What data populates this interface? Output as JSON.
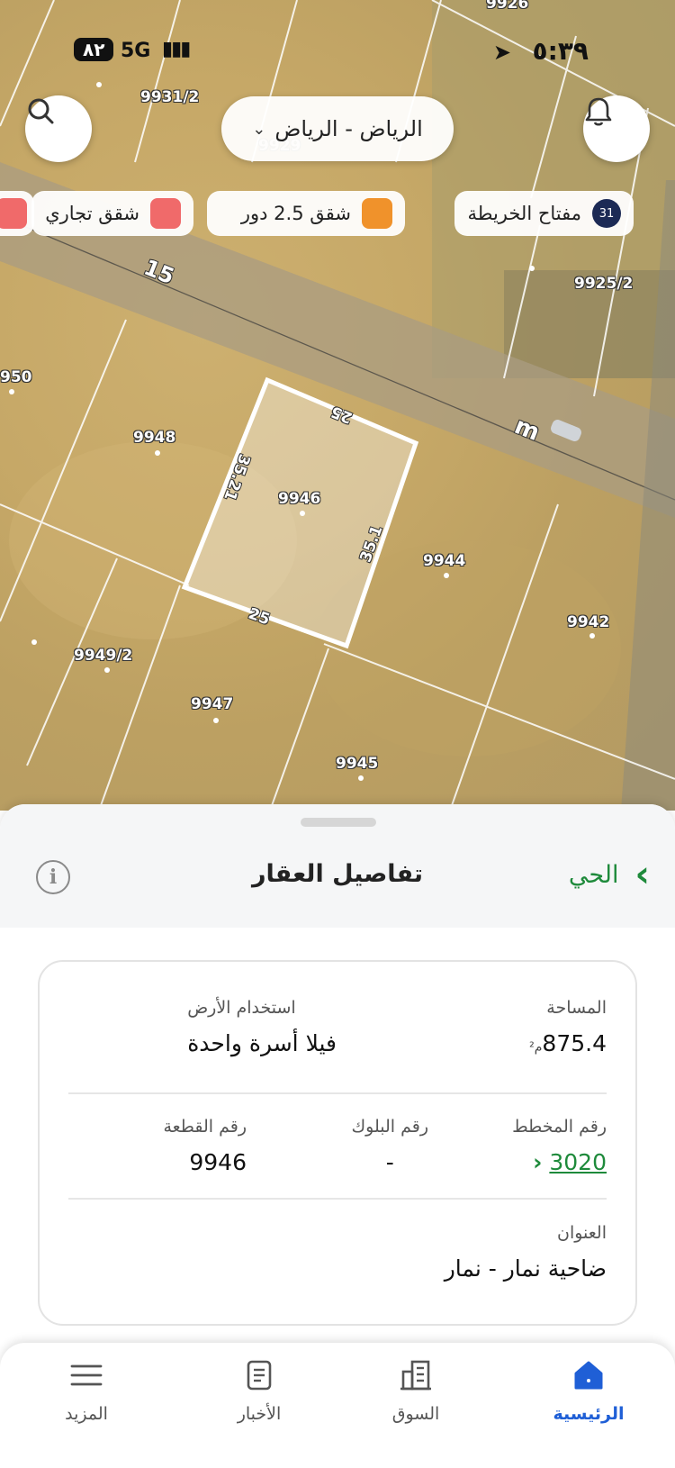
{
  "status_bar": {
    "time": "٥:٣٩",
    "network": "5G",
    "battery": "٨٢"
  },
  "header": {
    "city": "الرياض - الرياض"
  },
  "filters": [
    {
      "label": "مفتاح الخريطة",
      "badge": "31",
      "icon": "layers-badge"
    },
    {
      "label": "شقق 2.5 دور",
      "color": "#f0922b"
    },
    {
      "label": "شقق تجاري",
      "color": "#f06a6a"
    }
  ],
  "map": {
    "street_label": "15",
    "street_label_2": "m",
    "plot_labels": [
      "9926",
      "9931/2",
      "9929",
      "9925/2",
      "950",
      "9948",
      "9946",
      "9944",
      "9942",
      "9949/2",
      "9947",
      "9945"
    ],
    "dimensions": [
      "25",
      "35.21",
      "35.1",
      "25"
    ]
  },
  "sheet": {
    "title": "تفاصيل العقار",
    "neighborhood_link": "الحي",
    "area_label": "المساحة",
    "area_value": "875.4",
    "area_unit": "م²",
    "land_use_label": "استخدام الأرض",
    "land_use_value": "فيلا أسرة واحدة",
    "plan_label": "رقم المخطط",
    "plan_value": "3020",
    "block_label": "رقم البلوك",
    "block_value": "-",
    "parcel_label": "رقم القطعة",
    "parcel_value": "9946",
    "address_label": "العنوان",
    "address_value": "ضاحية نمار - نمار"
  },
  "tabbar": {
    "active_color": "#1f5fd6",
    "tabs": [
      {
        "label": "الرئيسية",
        "icon": "home-icon",
        "active": true
      },
      {
        "label": "السوق",
        "icon": "building-icon",
        "active": false
      },
      {
        "label": "الأخبار",
        "icon": "news-icon",
        "active": false
      },
      {
        "label": "المزيد",
        "icon": "menu-icon",
        "active": false
      }
    ]
  },
  "colors": {
    "accent_green": "#1e8a3b",
    "active_blue": "#1f5fd6"
  }
}
